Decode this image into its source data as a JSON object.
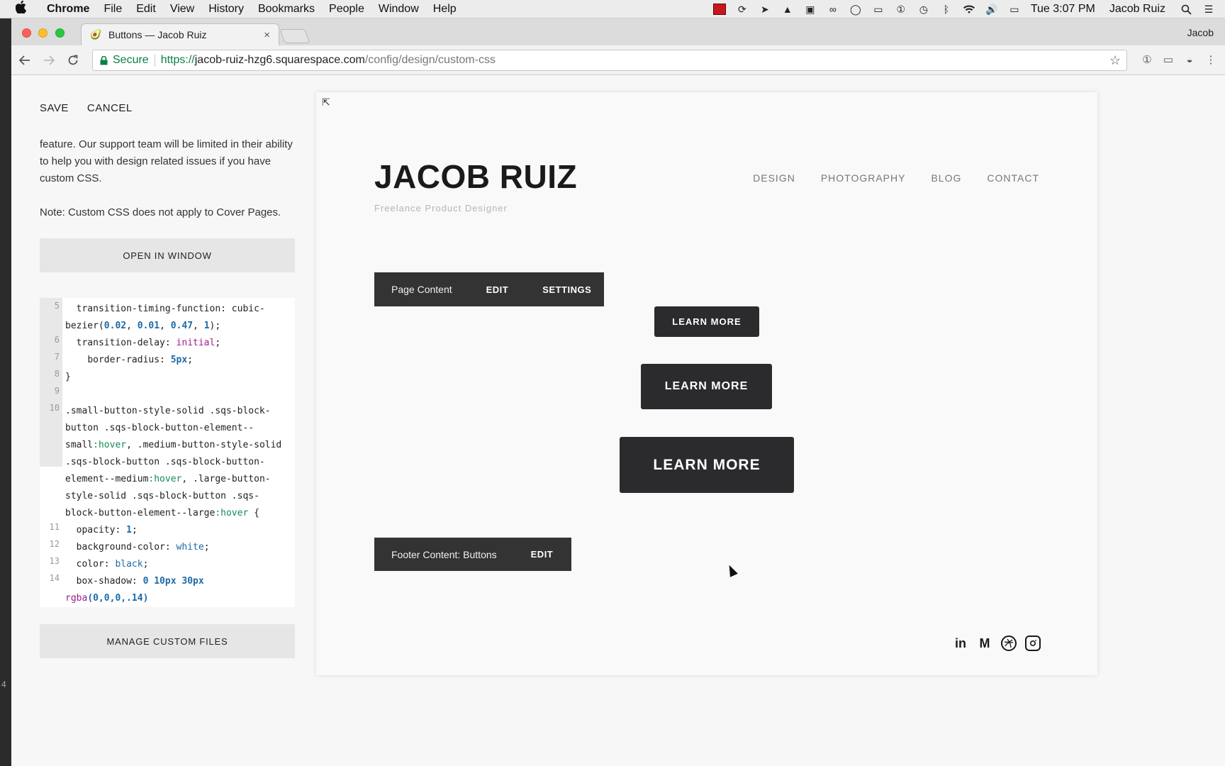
{
  "menubar": {
    "apple": "",
    "items": [
      "Chrome",
      "File",
      "Edit",
      "View",
      "History",
      "Bookmarks",
      "People",
      "Window",
      "Help"
    ],
    "clock": "Tue 3:07 PM",
    "user": "Jacob Ruiz"
  },
  "browser": {
    "tab_title": "Buttons — Jacob Ruiz",
    "tab_close": "×",
    "profile": "Jacob",
    "secure_label": "Secure",
    "url_scheme": "https://",
    "url_host": "jacob-ruiz-hzg6.squarespace.com",
    "url_path": "/config/design/custom-css"
  },
  "left_panel": {
    "save": "SAVE",
    "cancel": "CANCEL",
    "help_p1": "feature. Our support team will be limited in their ability to help you with design related issues if you have custom CSS.",
    "help_p2": "Note: Custom CSS does not apply to Cover Pages.",
    "open_in_window": "OPEN IN WINDOW",
    "manage_files": "MANAGE CUSTOM FILES",
    "edge_number": "4"
  },
  "code": {
    "ln5": "5",
    "ln6": "6",
    "ln7": "7",
    "ln8": "8",
    "ln9": "9",
    "ln10": "10",
    "ln11": "11",
    "ln12": "12",
    "ln13": "13",
    "ln14": "14",
    "l5_a": "  transition-timing-function: cubic-bezier(",
    "l5_n1": "0.02",
    "l5_c1": ", ",
    "l5_n2": "0.01",
    "l5_c2": ", ",
    "l5_n3": "0.47",
    "l5_c3": ", ",
    "l5_n4": "1",
    "l5_end": ");",
    "l6_a": "  transition-delay: ",
    "l6_v": "initial",
    "l6_end": ";",
    "l7_a": "    border-radius: ",
    "l7_v": "5px",
    "l7_end": ";",
    "l8": "}",
    "l10_a": ".small-button-style-solid .sqs-block-button .sqs-block-button-element--small",
    "l10_h1": ":hover",
    "l10_b": ", .medium-button-style-solid .sqs-block-button .sqs-block-button-element--medium",
    "l10_h2": ":hover",
    "l10_c": ", .large-button-style-solid .sqs-block-button .sqs-block-button-element--large",
    "l10_h3": ":hover",
    "l10_end": " {",
    "l11_a": "  opacity: ",
    "l11_v": "1",
    "l11_end": ";",
    "l12_a": "  background-color: ",
    "l12_v": "white",
    "l12_end": ";",
    "l13_a": "  color: ",
    "l13_v": "black",
    "l13_end": ";",
    "l14_a": "  box-shadow: ",
    "l14_v": "0 10px 30px",
    "l14_b": " ",
    "l14_fn": "rgba",
    "l14_args": "(0,0,0,.14)"
  },
  "preview": {
    "site_title": "JACOB RUIZ",
    "tagline": "Freelance Product Designer",
    "nav": [
      "DESIGN",
      "PHOTOGRAPHY",
      "BLOG",
      "CONTACT"
    ],
    "page_bar": {
      "label": "Page Content",
      "edit": "EDIT",
      "settings": "SETTINGS"
    },
    "footer_bar": {
      "label": "Footer Content: Buttons",
      "edit": "EDIT"
    },
    "learn_small": "LEARN MORE",
    "learn_medium": "LEARN MORE",
    "learn_large": "LEARN MORE",
    "social": {
      "linkedin": "in",
      "medium": "M"
    }
  },
  "colors": {
    "secure_green": "#0b8043",
    "button_dark": "#2b2b2d",
    "block_bar": "#333333"
  },
  "icons": [
    "apple-icon",
    "lock-icon",
    "star-icon",
    "back-icon",
    "forward-icon",
    "reload-icon",
    "collapse-icon",
    "linkedin-icon",
    "medium-icon",
    "dribbble-icon",
    "instagram-icon"
  ]
}
